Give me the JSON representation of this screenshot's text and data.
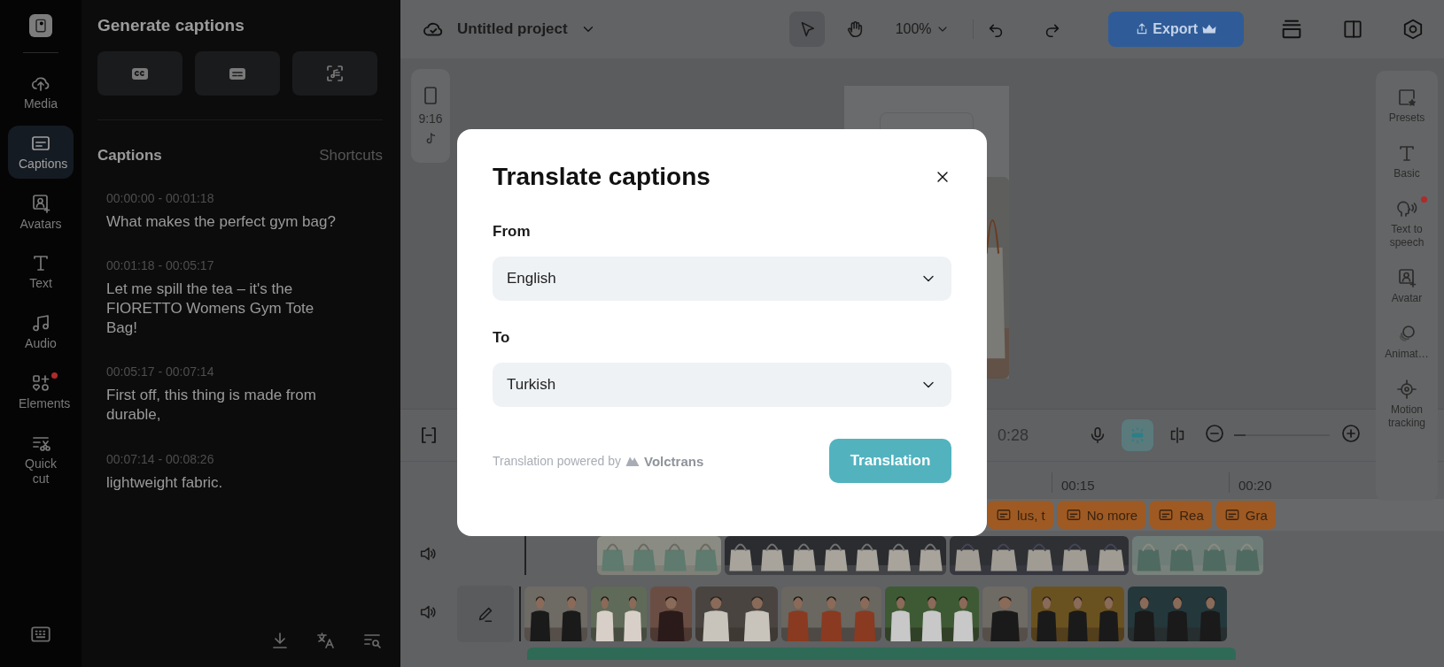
{
  "rail": {
    "items": [
      {
        "kind": "media",
        "label": "Media",
        "selected": false,
        "dot": false
      },
      {
        "kind": "captions",
        "label": "Captions",
        "selected": true,
        "dot": false
      },
      {
        "kind": "avatars",
        "label": "Avatars",
        "selected": false,
        "dot": false
      },
      {
        "kind": "text",
        "label": "Text",
        "selected": false,
        "dot": false
      },
      {
        "kind": "audio",
        "label": "Audio",
        "selected": false,
        "dot": false
      },
      {
        "kind": "elements",
        "label": "Elements",
        "selected": false,
        "dot": true
      },
      {
        "kind": "quickcut",
        "label": "Quick cut",
        "selected": false,
        "dot": false
      }
    ]
  },
  "captions_panel": {
    "title": "Generate captions",
    "heading": "Captions",
    "shortcuts": "Shortcuts",
    "entries": [
      {
        "time": "00:00:00 - 00:01:18",
        "text": "What makes the perfect gym bag?"
      },
      {
        "time": "00:01:18 - 00:05:17",
        "text": "Let me spill the tea – it's the FIORETTO Womens Gym Tote Bag!"
      },
      {
        "time": "00:05:17 - 00:07:14",
        "text": "First off, this thing is made from durable,"
      },
      {
        "time": "00:07:14 - 00:08:26",
        "text": "lightweight fabric."
      }
    ]
  },
  "header": {
    "project": "Untitled project",
    "tools": [
      {
        "kind": "select",
        "selected": true
      },
      {
        "kind": "hand",
        "selected": false
      }
    ],
    "zoom": "100%",
    "export": "Export"
  },
  "canvas": {
    "aspect": "9:16"
  },
  "right_panel": {
    "items": [
      {
        "kind": "presets",
        "label": "Presets",
        "dot": false
      },
      {
        "kind": "basic",
        "label": "Basic",
        "dot": false
      },
      {
        "kind": "tts",
        "label": "Text to speech",
        "dot": true
      },
      {
        "kind": "avatar",
        "label": "Avatar",
        "dot": false
      },
      {
        "kind": "animation",
        "label": "Animat…",
        "dot": false
      },
      {
        "kind": "motion",
        "label": "Motion tracking",
        "dot": false
      }
    ]
  },
  "timeline": {
    "timecode": "0:28",
    "tools": [
      {
        "kind": "mic",
        "selected": false
      },
      {
        "kind": "snap",
        "selected": true
      },
      {
        "kind": "split",
        "selected": false
      }
    ],
    "zoom": {
      "level": 0.12
    },
    "ruler": [
      "00:15",
      "00:20"
    ],
    "caption_chips": [
      "lus, t",
      "No more",
      "Rea",
      "Gra"
    ]
  },
  "dialog": {
    "title": "Translate captions",
    "from_label": "From",
    "from": "English",
    "to_label": "To",
    "to": "Turkish",
    "powered_by": "Translation powered by",
    "brand": "Volctrans",
    "button": "Translation"
  }
}
